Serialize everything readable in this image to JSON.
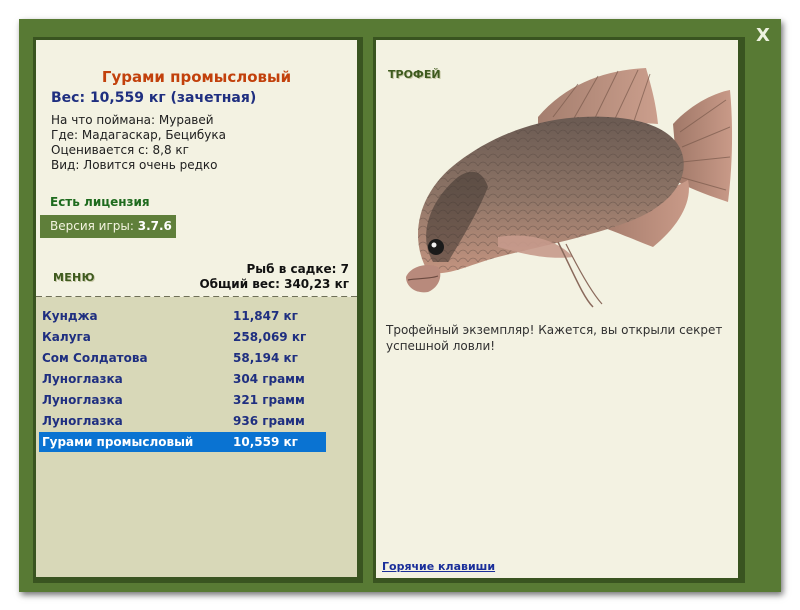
{
  "close_label": "X",
  "fish": {
    "title": "Гурами промысловый",
    "weight": "Вес: 10,559 кг (зачетная)",
    "bait": "На что поймана: Муравей",
    "location": "Где: Мадагаскар, Бецибука",
    "value": "Оценивается с: 8,8 кг",
    "rarity": "Вид: Ловится очень редко"
  },
  "license": "Есть лицензия",
  "version": {
    "label": "Версия игры:",
    "value": "3.7.6"
  },
  "menu_label": "МЕНЮ",
  "cage": {
    "count": "Рыб в садке: 7",
    "total": "Общий вес: 340,23 кг"
  },
  "catches": [
    {
      "name": "Кунджа",
      "weight": "11,847 кг"
    },
    {
      "name": "Калуга",
      "weight": "258,069 кг"
    },
    {
      "name": "Сом Солдатова",
      "weight": "58,194 кг"
    },
    {
      "name": "Луноглазка",
      "weight": "304 грамм"
    },
    {
      "name": "Луноглазка",
      "weight": "321 грамм"
    },
    {
      "name": "Луноглазка",
      "weight": "936 грамм"
    },
    {
      "name": "Гурами промысловый",
      "weight": "10,559 кг"
    }
  ],
  "selected_index": 6,
  "trophy_label": "ТРОФЕЙ",
  "description": "Трофейный экземпляр! Кажется, вы открыли секрет успешной ловли!",
  "hotkeys_link": "Горячие клавиши",
  "colors": {
    "frame": "#587a34",
    "panel_bg": "#f3f2e2",
    "list_bg": "#d8d8b8",
    "selected": "#0a73d2",
    "title": "#c2410c",
    "text_blue": "#1f2f80"
  }
}
